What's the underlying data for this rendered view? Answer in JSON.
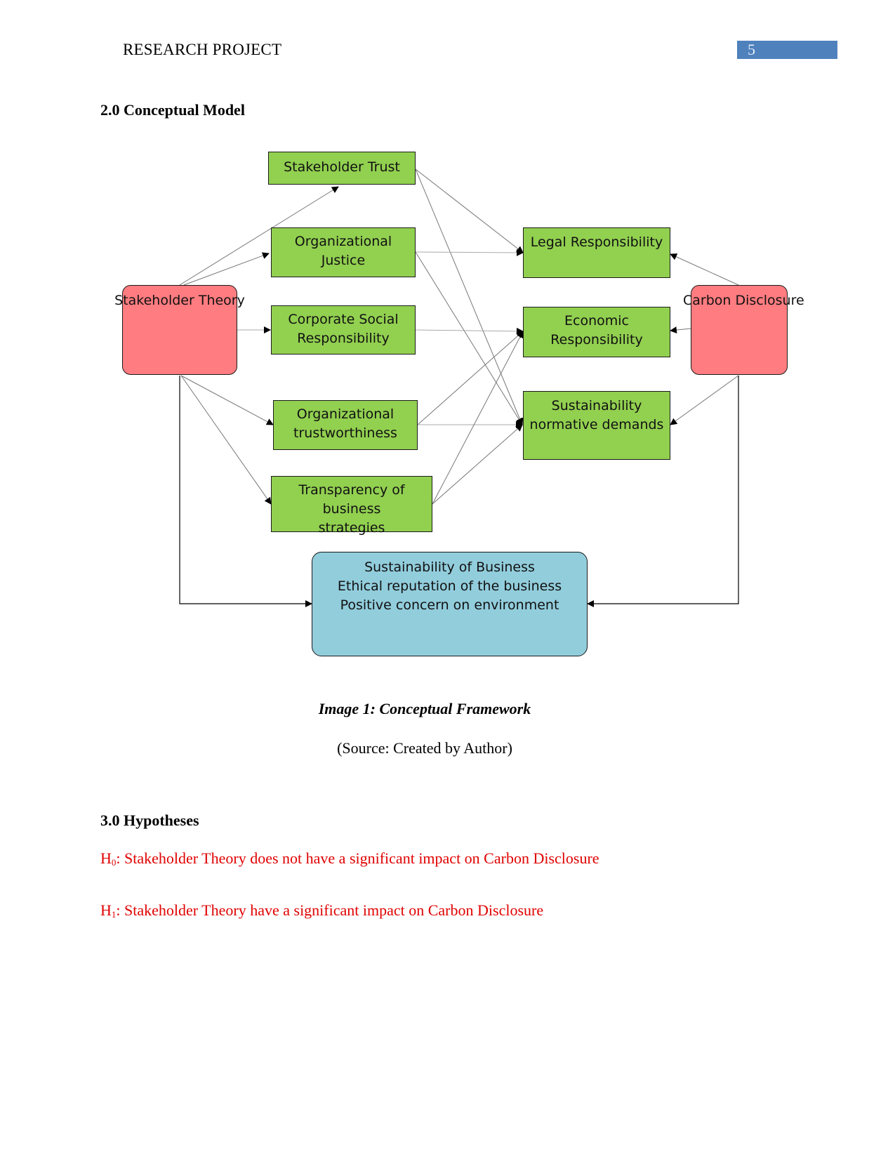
{
  "header": {
    "title": "RESEARCH PROJECT",
    "page_number": "5",
    "page_number_bg": "#4f81bd"
  },
  "sections": {
    "model_heading": "2.0 Conceptual Model",
    "hypotheses_heading": "3.0 Hypotheses"
  },
  "diagram": {
    "nodes": {
      "stakeholder_theory": "Stakeholder Theory",
      "carbon_disclosure": "Carbon Disclosure",
      "stakeholder_trust": "Stakeholder Trust",
      "organizational_justice": "Organizational Justice",
      "csr": "Corporate Social Responsibility",
      "org_trustworthiness": "Organizational trustworthiness",
      "transparency": "Transparency of business strategies",
      "legal_responsibility": "Legal Responsibility",
      "economic_responsibility": "Economic Responsibility",
      "sustainability_demands": "Sustainability normative demands",
      "outcome_line1": "Sustainability of Business",
      "outcome_line2": "Ethical reputation of the business",
      "outcome_line3": "Positive concern on environment"
    },
    "colors": {
      "theory": "#ff7c80",
      "mediator": "#92d050",
      "outcome": "#92cddc"
    },
    "edges": [
      {
        "from": "stakeholder_theory",
        "to": "stakeholder_trust"
      },
      {
        "from": "stakeholder_theory",
        "to": "organizational_justice"
      },
      {
        "from": "stakeholder_theory",
        "to": "csr"
      },
      {
        "from": "stakeholder_theory",
        "to": "org_trustworthiness"
      },
      {
        "from": "stakeholder_theory",
        "to": "transparency"
      },
      {
        "from": "stakeholder_theory",
        "to": "outcome"
      },
      {
        "from": "stakeholder_trust",
        "to": "legal_responsibility"
      },
      {
        "from": "stakeholder_trust",
        "to": "sustainability_demands"
      },
      {
        "from": "organizational_justice",
        "to": "legal_responsibility"
      },
      {
        "from": "organizational_justice",
        "to": "sustainability_demands"
      },
      {
        "from": "csr",
        "to": "economic_responsibility"
      },
      {
        "from": "org_trustworthiness",
        "to": "economic_responsibility"
      },
      {
        "from": "org_trustworthiness",
        "to": "sustainability_demands"
      },
      {
        "from": "transparency",
        "to": "economic_responsibility"
      },
      {
        "from": "transparency",
        "to": "sustainability_demands"
      },
      {
        "from": "carbon_disclosure",
        "to": "legal_responsibility"
      },
      {
        "from": "carbon_disclosure",
        "to": "economic_responsibility"
      },
      {
        "from": "carbon_disclosure",
        "to": "sustainability_demands"
      },
      {
        "from": "carbon_disclosure",
        "to": "outcome"
      }
    ]
  },
  "caption": {
    "title": "Image 1: Conceptual Framework",
    "source": "(Source: Created by Author)"
  },
  "hypotheses": [
    {
      "label": "H",
      "subscript": "0",
      "text": ": Stakeholder Theory does not have a significant impact on Carbon Disclosure"
    },
    {
      "label": "H",
      "subscript": "1",
      "text": ": Stakeholder Theory have a significant impact on Carbon Disclosure"
    }
  ],
  "hypothesis_color": "#e00000"
}
